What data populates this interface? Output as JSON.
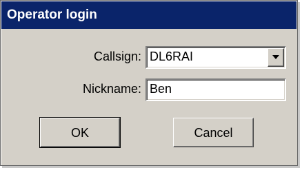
{
  "window": {
    "title": "Operator login"
  },
  "form": {
    "callsign_label": "Callsign:",
    "callsign_value": "DL6RAI",
    "nickname_label": "Nickname:",
    "nickname_value": "Ben"
  },
  "buttons": {
    "ok": "OK",
    "cancel": "Cancel"
  },
  "icons": {
    "dropdown": "chevron-down-icon"
  },
  "colors": {
    "titlebar": "#0a246a",
    "face": "#d4d0c8"
  }
}
